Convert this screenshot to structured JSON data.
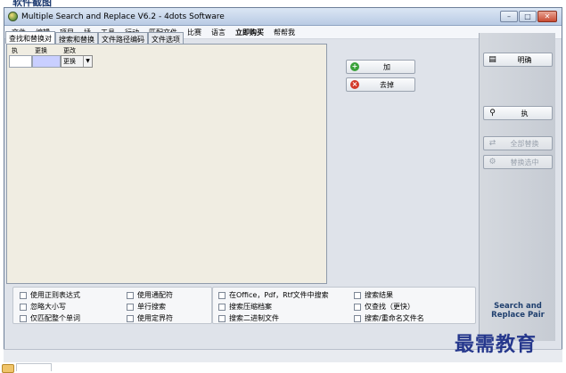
{
  "page_header": "软件截图",
  "window": {
    "title": "Multiple Search and Replace V6.2 - 4dots Software",
    "controls": {
      "minimize": "–",
      "maximize": "□",
      "close": "✕"
    }
  },
  "menu": [
    "文件",
    "编辑",
    "项目",
    "插",
    "工具",
    "行动",
    "匹配文件",
    "比赛",
    "语言",
    "立即购买",
    "帮帮我"
  ],
  "tabs": [
    "查找和替换对",
    "搜索和替换",
    "文件路径编码",
    "文件选项"
  ],
  "grid": {
    "headers": [
      "执",
      "更换",
      "更改"
    ],
    "select_value": "更换"
  },
  "mid_buttons": {
    "add": "加",
    "remove": "去掉"
  },
  "right_buttons": {
    "help": "明确",
    "search": "执",
    "replace_all": "全部替换",
    "replace_selected": "替换选中"
  },
  "brand": {
    "line1": "Search and",
    "line2": "Replace Pair"
  },
  "options": {
    "group1": [
      "使用正则表达式",
      "忽略大小写",
      "仅匹配整个单词"
    ],
    "group2": [
      "使用通配符",
      "单行搜索",
      "使用定界符"
    ],
    "group3": [
      "在Office，Pdf，Rtf文件中搜索",
      "搜索压缩档案",
      "搜索二进制文件"
    ],
    "group4": [
      "搜索结果",
      "仅查找（更快）",
      "搜索/重命名文件名"
    ]
  },
  "watermark": "最需教育",
  "colors": {
    "accent": "#1f3f6e",
    "grid_highlight": "#c9cfff",
    "add_icon": "#3aa13a",
    "remove_icon": "#d33a2a"
  }
}
